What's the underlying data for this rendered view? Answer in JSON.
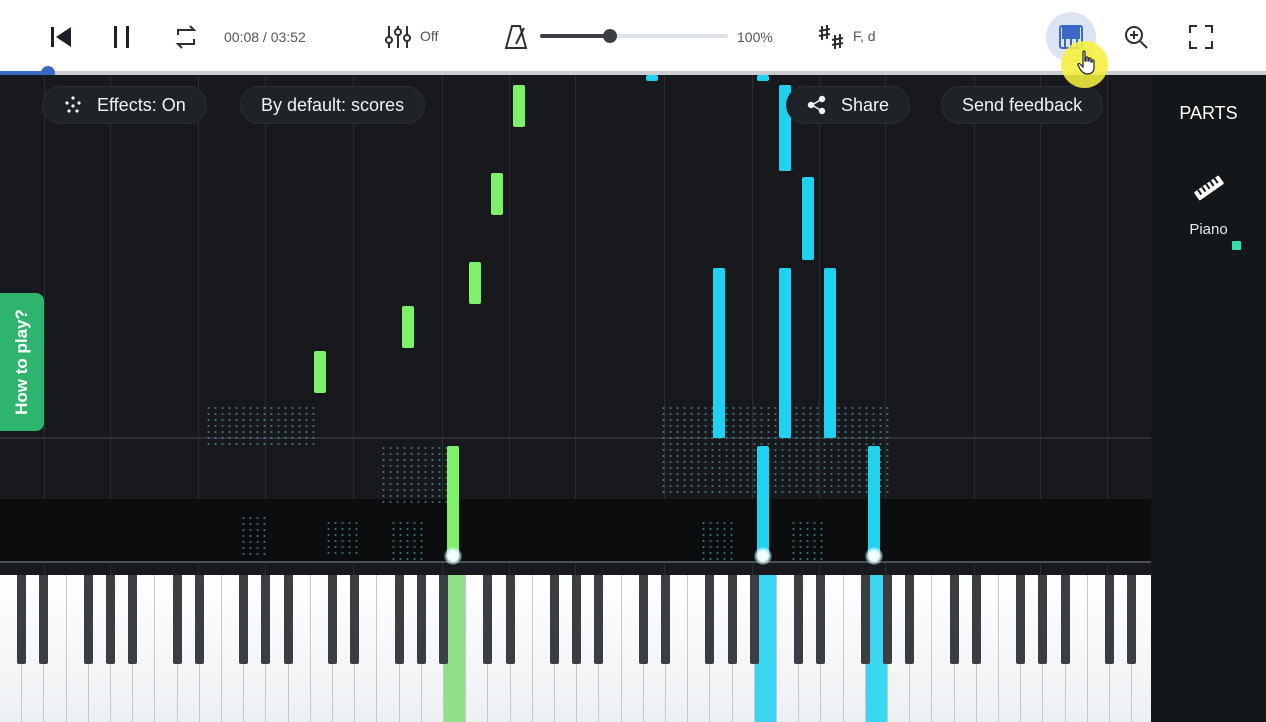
{
  "toolbar": {
    "time": "00:08 / 03:52",
    "mixer_state": "Off",
    "speed": "100%",
    "key": "F, d",
    "speed_fraction": 0.37
  },
  "playback": {
    "progress_fraction": 0.0376
  },
  "overlay": {
    "effects_label": "Effects: On",
    "default_label": "By default: scores",
    "share_label": "Share",
    "feedback_label": "Send feedback",
    "how_to_play": "How to play?"
  },
  "parts": {
    "title": "PARTS",
    "items": [
      {
        "label": "Piano",
        "color": "#35e0b0"
      }
    ]
  },
  "colors": {
    "left_hand": "#7ef06a",
    "right_hand": "#1fd3f0",
    "accent": "#3b68c5",
    "how_to_play_bg": "#2fb46d"
  },
  "icons": {
    "prev": "skip-back-icon",
    "pause": "pause-icon",
    "loop": "loop-icon",
    "mixer": "mixer-icon",
    "metronome": "metronome-icon",
    "key": "key-signature-icon",
    "keyboard": "piano-keyboard-icon",
    "zoom": "zoom-in-icon",
    "fullscreen": "fullscreen-icon",
    "effects": "sparkle-icon",
    "share": "share-icon",
    "part": "piano-part-icon"
  }
}
